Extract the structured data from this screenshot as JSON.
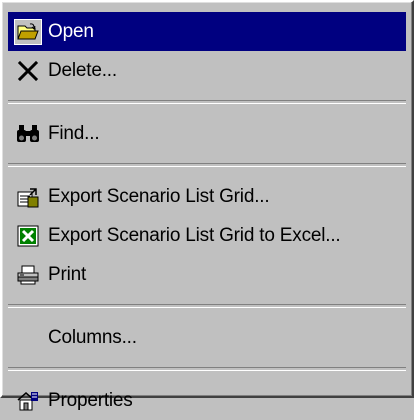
{
  "menu": {
    "items": [
      {
        "label": "Open",
        "icon": "folder-open-icon",
        "selected": true
      },
      {
        "label": "Delete...",
        "icon": "delete-x-icon"
      },
      {
        "label": "Find...",
        "icon": "binoculars-icon"
      },
      {
        "label": "Export Scenario List Grid...",
        "icon": "export-icon"
      },
      {
        "label": "Export Scenario List Grid to Excel...",
        "icon": "excel-icon"
      },
      {
        "label": "Print",
        "icon": "printer-icon"
      },
      {
        "label": "Columns...",
        "icon": ""
      },
      {
        "label": "Properties",
        "icon": "properties-icon"
      }
    ]
  },
  "colors": {
    "menu_face": "#c0c0c0",
    "highlight": "#000080",
    "highlight_text": "#ffffff"
  }
}
